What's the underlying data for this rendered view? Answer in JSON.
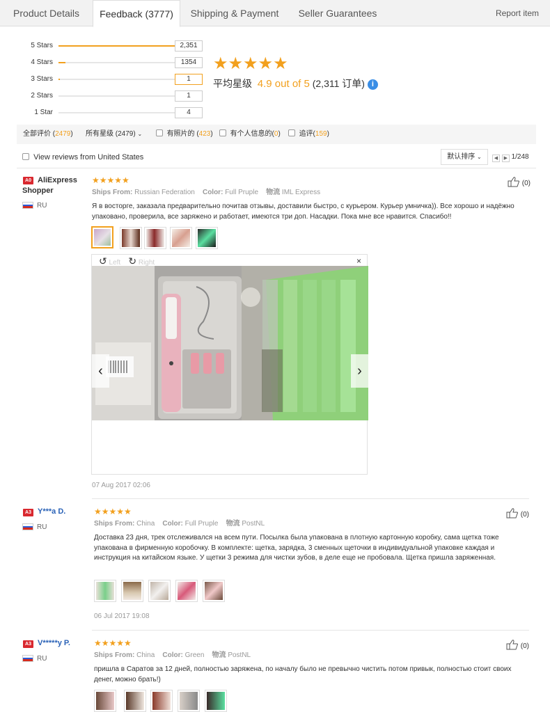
{
  "tabs": [
    {
      "label": "Product Details"
    },
    {
      "label": "Feedback (3777)"
    },
    {
      "label": "Shipping & Payment"
    },
    {
      "label": "Seller Guarantees"
    }
  ],
  "report_label": "Report item",
  "rating_breakdown": [
    {
      "label": "5 Stars",
      "count": "2,351",
      "fraction": 0.94
    },
    {
      "label": "4 Stars",
      "count": "1354",
      "fraction": 0.05
    },
    {
      "label": "3 Stars",
      "count": "1",
      "fraction": 0.01
    },
    {
      "label": "2 Stars",
      "count": "1",
      "fraction": 0.0
    },
    {
      "label": "1 Star",
      "count": "4",
      "fraction": 0.0
    }
  ],
  "average": {
    "stars": "★★★★★",
    "prefix": "平均星级",
    "score": "4.9 out of 5",
    "orders": "(2,311 订单)",
    "info_icon": "info-icon"
  },
  "filters": {
    "all_label": "全部评价 (",
    "all_count": "2479",
    "all_close": ")",
    "stars_select": "所有星级 (2479)",
    "photos_label": "有照片的 (",
    "photos_count": "423",
    "photos_close": ")",
    "personal_label": "有个人信息的(",
    "personal_count": "0",
    "personal_close": ")",
    "append_label": "追评(",
    "append_count": "159",
    "append_close": ")"
  },
  "us_reviews_label": "View reviews from United States",
  "sort_label": "默认排序",
  "pager": {
    "text": "1/248"
  },
  "reviews": [
    {
      "badge": "A0",
      "name_line1": "AliExpress",
      "name_line2": "Shopper",
      "country": "RU",
      "stars": "★★★★★",
      "ships_from_label": "Ships From:",
      "ships_from": "Russian Federation",
      "color_label": "Color:",
      "color": "Full Pruple",
      "logistics_label": "物流",
      "logistics": "IML Express",
      "text": "Я в восторге, заказала предварительно почитав отзывы, доставили быстро, с курьером. Курьер умничка)). Все хорошо и надёжно упаковано, проверила, все заряжено и работает, имеются три доп. Насадки. Пока мне все нравится. Спасибо!!",
      "date": "07 Aug 2017 02:06",
      "likes": "(0)"
    },
    {
      "badge": "A3",
      "name_line1": "Y***a D.",
      "country": "RU",
      "stars": "★★★★★",
      "ships_from_label": "Ships From:",
      "ships_from": "China",
      "color_label": "Color:",
      "color": "Full Pruple",
      "logistics_label": "物流",
      "logistics": "PostNL",
      "text": "Доставка 23 дня, трек отслеживался на всем пути. Посылка была упакована в плотную картонную коробку, сама щетка тоже упакована в фирменную коробочку. В комплекте: щетка, зарядка, 3 сменных щеточки в индивидуальной упаковке каждая и инструкция на китайском языке. У щетки 3 режима для чистки зубов, в деле еще не пробовала. Щетка пришла заряженная.",
      "date": "06 Jul 2017 19:08",
      "likes": "(0)"
    },
    {
      "badge": "A3",
      "name_line1": "V*****y P.",
      "country": "RU",
      "stars": "★★★★★",
      "ships_from_label": "Ships From:",
      "ships_from": "China",
      "color_label": "Color:",
      "color": "Green",
      "logistics_label": "物流",
      "logistics": "PostNL",
      "text": "пришла в Саратов за 12 дней, полностью заряжена, по началу было не превычно чистить потом привык, полностью стоит своих денег, можно брать!)",
      "likes": "(0)"
    }
  ],
  "viewer": {
    "rotate_left": "Left",
    "rotate_right": "Right",
    "close": "×",
    "prev": "‹",
    "next": "›"
  }
}
